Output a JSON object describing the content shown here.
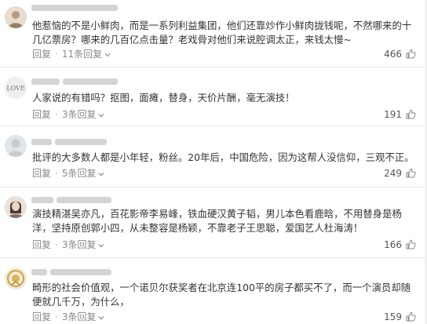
{
  "ui": {
    "reply_label": "回复",
    "like_icon": "thumbs-up-icon",
    "chevron_icon": "chevron-down-icon"
  },
  "comments": [
    {
      "username": "baidu_dd5d427150...",
      "avatar_icon": "user-avatar",
      "text": "他惹恼的不是小鲜肉，而是一系列利益集团，他们还靠炒作小鲜肉拢钱呢，不然哪来的十几亿票房？哪来的几百亿点击量？老戏骨对他们来说腔调太正，来钱太慢~",
      "reply_count": "11条回复",
      "likes": "466"
    },
    {
      "username": "",
      "avatar_icon": "love-avatar",
      "text": "人家说的有错吗？抠图，面瘫，替身，天价片酬，毫无演技！",
      "reply_count": "3条回复",
      "likes": "191"
    },
    {
      "username": "",
      "avatar_icon": "default-avatar",
      "text": "批评的大多数人都是小年轻，粉丝。20年后，中国危险，因为这帮人没信仰，三观不正。",
      "reply_count": "5条回复",
      "likes": "249"
    },
    {
      "username": "",
      "avatar_icon": "portrait-avatar",
      "text": "演技精湛吴亦凡，百花影帝李易峰，铁血硬汉黄子韬，男儿本色看鹿晗，不用替身是杨洋，坚持原创郭小四，从未整容是杨颖，不靠老子王思聪，爱国艺人杜海涛！",
      "reply_count": "3条回复",
      "likes": "166"
    },
    {
      "username": "",
      "avatar_icon": "emblem-avatar",
      "text": "畸形的社会价值观，一个诺贝尔获奖者在北京连100平的房子都买不了，而一个演员却随便就几千万，为什么，",
      "reply_count": "3条回复",
      "likes": "159"
    }
  ],
  "colors": {
    "text": "#333333",
    "meta": "#8a8a8a",
    "divider": "#e6e6e6"
  }
}
